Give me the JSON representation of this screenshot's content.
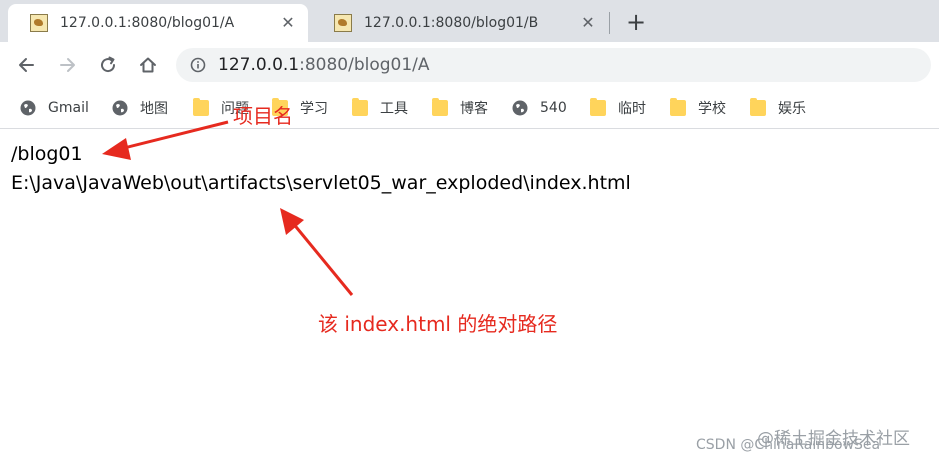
{
  "tabs": [
    {
      "title": "127.0.0.1:8080/blog01/A",
      "close": "✕"
    },
    {
      "title": "127.0.0.1:8080/blog01/B",
      "close": "✕"
    }
  ],
  "new_tab": "+",
  "address": {
    "host": "127.0.0.1",
    "rest": ":8080/blog01/A"
  },
  "bookmarks": [
    {
      "label": "Gmail",
      "icon": "globe-icon"
    },
    {
      "label": "地图",
      "icon": "globe-icon"
    },
    {
      "label": "问题",
      "icon": "folder-icon"
    },
    {
      "label": "学习",
      "icon": "folder-icon"
    },
    {
      "label": "工具",
      "icon": "folder-icon"
    },
    {
      "label": "博客",
      "icon": "folder-icon"
    },
    {
      "label": "540",
      "icon": "globe-icon"
    },
    {
      "label": "临时",
      "icon": "folder-icon"
    },
    {
      "label": "学校",
      "icon": "folder-icon"
    },
    {
      "label": "娱乐",
      "icon": "folder-icon"
    }
  ],
  "page": {
    "line1": "/blog01",
    "line2": "E:\\Java\\JavaWeb\\out\\artifacts\\servlet05_war_exploded\\index.html"
  },
  "annotations": {
    "project_name": "项目名",
    "absolute_path": "该 index.html 的绝对路径",
    "color": "#e62a1f"
  },
  "watermarks": {
    "juejin": "@稀土掘金技术社区",
    "csdn": "CSDN @ChinaRainbowSea"
  }
}
